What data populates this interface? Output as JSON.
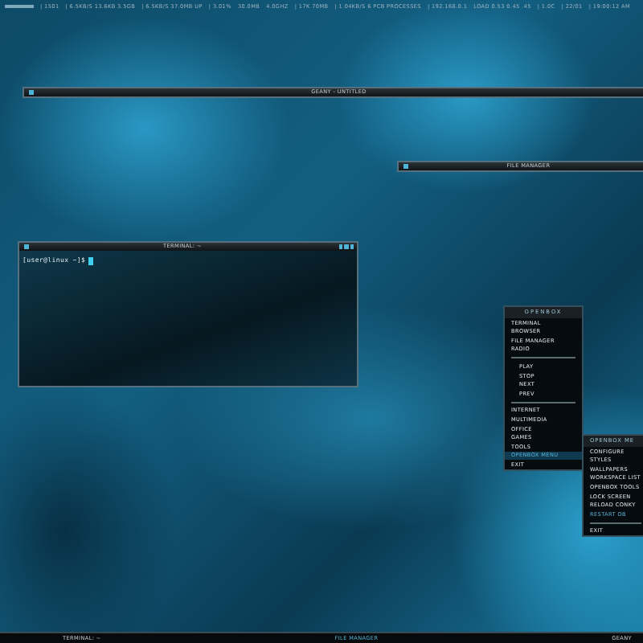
{
  "top_bar": {
    "segments": [
      "| 1501",
      "| 6.5KB/S 13.6KB 3.5GB",
      "| 6.5KB/S 37.0MB UP",
      "| 3.01%",
      "30.0MB",
      "4.0GHZ",
      "| 17K 70MB",
      "| 1.04KB/S 6 PCB PROCESSES",
      "| 192.168.0.1",
      "LOAD 0.53 0.45 .45",
      "| 1.0C",
      "| 22/01",
      "| 19:00:12 AM"
    ]
  },
  "windows": [
    {
      "kind": "shaded",
      "title": "GEANY - UNTITLED"
    },
    {
      "kind": "shaded",
      "title": "FILE MANAGER"
    },
    {
      "kind": "terminal",
      "title": "TERMINAL: ~",
      "prompt": "[user@linux ~]$"
    }
  ],
  "menu": {
    "title": "OPENBOX",
    "items": [
      {
        "kind": "item",
        "label": "TERMINAL",
        "selected": false
      },
      {
        "kind": "item",
        "label": "BROWSER",
        "selected": false
      },
      {
        "kind": "item",
        "label": "FILE MANAGER",
        "selected": false
      },
      {
        "kind": "item",
        "label": "RADIO",
        "selected": false
      },
      {
        "kind": "separator"
      },
      {
        "kind": "indented",
        "label": "PLAY",
        "selected": false
      },
      {
        "kind": "indented",
        "label": "STOP",
        "selected": false
      },
      {
        "kind": "indented",
        "label": "NEXT",
        "selected": false
      },
      {
        "kind": "indented",
        "label": "PREV",
        "selected": false
      },
      {
        "kind": "separator"
      },
      {
        "kind": "item",
        "label": "INTERNET",
        "selected": false
      },
      {
        "kind": "item",
        "label": "MULTIMEDIA",
        "selected": false
      },
      {
        "kind": "item",
        "label": "OFFICE",
        "selected": false
      },
      {
        "kind": "item",
        "label": "GAMES",
        "selected": false
      },
      {
        "kind": "item",
        "label": "TOOLS",
        "selected": false
      },
      {
        "kind": "item",
        "label": "OPENBOX MENU",
        "selected": true
      },
      {
        "kind": "item",
        "label": "EXIT",
        "selected": false
      }
    ]
  },
  "submenu": {
    "title": "OPENBOX ME",
    "items": [
      {
        "kind": "item",
        "label": "CONFIGURE",
        "disabled": false
      },
      {
        "kind": "item",
        "label": "STYLES",
        "disabled": false
      },
      {
        "kind": "item",
        "label": "WALLPAPERS",
        "disabled": false
      },
      {
        "kind": "item",
        "label": "WORKSPACE LIST",
        "disabled": false
      },
      {
        "kind": "item",
        "label": "OPENBOX TOOLS",
        "disabled": false
      },
      {
        "kind": "item",
        "label": "LOCK SCREEN",
        "disabled": false
      },
      {
        "kind": "item",
        "label": "RELOAD CONKY",
        "disabled": false
      },
      {
        "kind": "item",
        "label": "RESTART OB",
        "disabled": true
      },
      {
        "kind": "separator"
      },
      {
        "kind": "item",
        "label": "EXIT",
        "disabled": false
      }
    ]
  },
  "taskbar": {
    "tasks": [
      {
        "label": "TERMINAL: ~",
        "selected": false
      },
      {
        "label": "FILE MANAGER",
        "selected": true
      },
      {
        "label": "GEANY",
        "selected": false
      }
    ]
  }
}
